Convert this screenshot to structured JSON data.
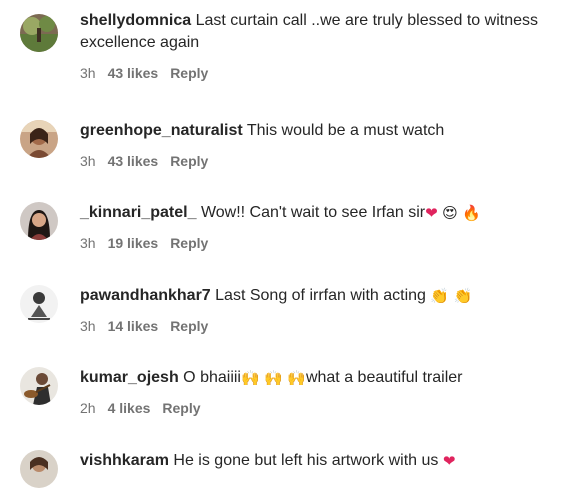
{
  "comments": [
    {
      "username": "shellydomnica",
      "text": "Last curtain call ..we are truly blessed to witness excellence again",
      "time": "3h",
      "likes": "43 likes",
      "reply": "Reply"
    },
    {
      "username": "greenhope_naturalist",
      "text": "This would be a must watch",
      "time": "3h",
      "likes": "43 likes",
      "reply": "Reply"
    },
    {
      "username": "_kinnari_patel_",
      "text": "Wow!! Can't wait to see Irfan sir",
      "emojis": [
        "heart",
        "heart-eyes",
        "fire"
      ],
      "time": "3h",
      "likes": "19 likes",
      "reply": "Reply"
    },
    {
      "username": "pawandhankhar7",
      "text": "Last Song of irrfan with acting",
      "emojis": [
        "clapping-hands",
        "clapping-hands"
      ],
      "time": "3h",
      "likes": "14 likes",
      "reply": "Reply"
    },
    {
      "username": "kumar_ojesh",
      "text_before": "O bhaiiii",
      "emojis": [
        "raising-hands",
        "raising-hands",
        "raising-hands"
      ],
      "text_after": "what a beautiful trailer",
      "time": "2h",
      "likes": "4 likes",
      "reply": "Reply"
    },
    {
      "username": "vishhkaram",
      "text": "He is gone but left his artwork with us",
      "emojis": [
        "heart"
      ],
      "time": "",
      "likes": "",
      "reply": ""
    }
  ],
  "colors": {
    "text": "#262626",
    "meta": "#737373",
    "heart": "#e0245e",
    "background": "#ffffff"
  }
}
